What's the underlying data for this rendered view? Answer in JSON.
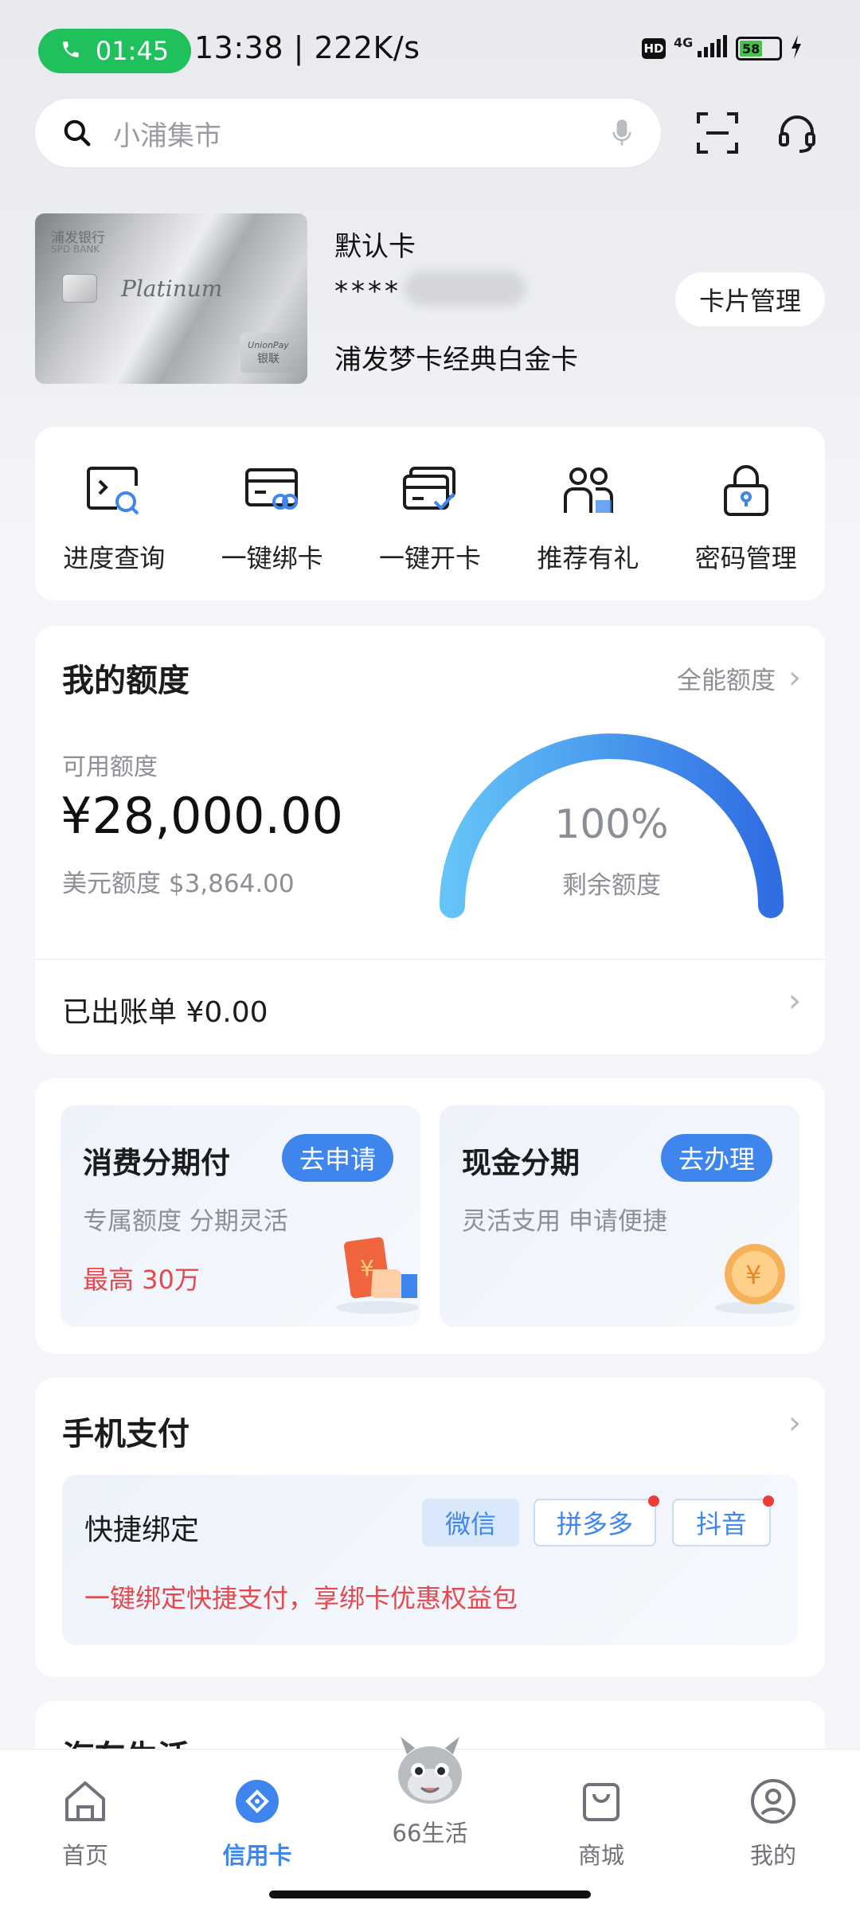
{
  "status_bar": {
    "call_timer": "01:45",
    "time_speed": "13:38 | 222K/s",
    "hd_badge": "HD",
    "network": "4G",
    "battery_level": "58"
  },
  "search": {
    "placeholder": "小浦集市"
  },
  "card": {
    "title": "默认卡",
    "number_masked": "****",
    "name": "浦发梦卡经典白金卡",
    "manage_button": "卡片管理",
    "image_text": {
      "bank_cn": "浦发银行",
      "bank_en": "SPD BANK",
      "tier": "Platinum",
      "network_en": "UnionPay",
      "network_cn": "银联"
    }
  },
  "quick_actions": [
    {
      "label": "进度查询",
      "icon": "progress-search-icon"
    },
    {
      "label": "一键绑卡",
      "icon": "bind-card-icon"
    },
    {
      "label": "一键开卡",
      "icon": "open-card-icon"
    },
    {
      "label": "推荐有礼",
      "icon": "referral-icon"
    },
    {
      "label": "密码管理",
      "icon": "password-lock-icon"
    }
  ],
  "credit": {
    "title": "我的额度",
    "all_limit_link": "全能额度",
    "available_label": "可用额度",
    "available_amount": "¥28,000.00",
    "usd_limit": "美元额度 $3,864.00",
    "gauge_percent": "100%",
    "gauge_label": "剩余额度",
    "gauge_fraction": 1.0,
    "gauge_colors": [
      "#64c3f7",
      "#2f6de3"
    ],
    "bill_text": "已出账单 ¥0.00"
  },
  "installments": [
    {
      "title": "消费分期付",
      "button": "去申请",
      "subtitle": "专属额度 分期灵活",
      "highlight": "最高 30万",
      "icon": "red-envelope-icon"
    },
    {
      "title": "现金分期",
      "button": "去办理",
      "subtitle": "灵活支用 申请便捷",
      "highlight": "",
      "icon": "gold-coin-icon"
    }
  ],
  "mobile_pay": {
    "title": "手机支付",
    "quick_bind_label": "快捷绑定",
    "options": [
      "微信",
      "拼多多",
      "抖音"
    ],
    "promo_text": "一键绑定快捷支付，享绑卡优惠权益包"
  },
  "next_section_title": "汽车生活",
  "bottom_nav": [
    {
      "label": "首页",
      "active": false
    },
    {
      "label": "信用卡",
      "active": true
    },
    {
      "label": "66生活",
      "active": false
    },
    {
      "label": "商城",
      "active": false
    },
    {
      "label": "我的",
      "active": false
    }
  ],
  "colors": {
    "accent": "#3e86ee",
    "promo_red": "#e5484d",
    "call_green": "#20c05c"
  }
}
